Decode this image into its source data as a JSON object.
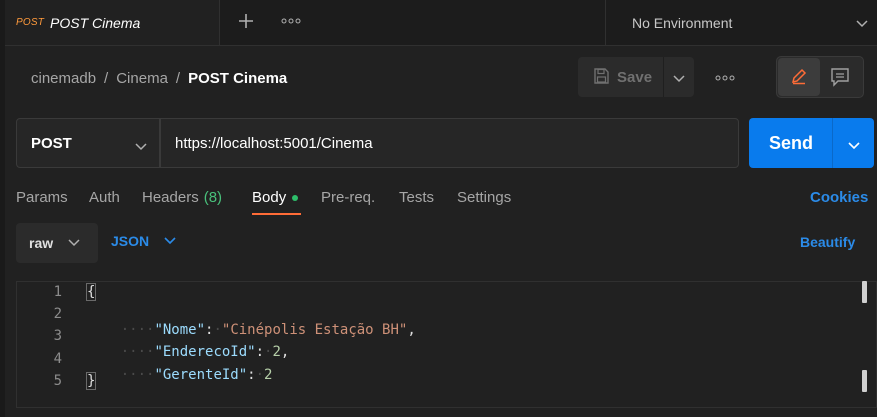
{
  "tab": {
    "method": "POST",
    "title": "POST Cinema"
  },
  "environment": {
    "label": "No Environment"
  },
  "breadcrumb": {
    "collection": "cinemadb",
    "folder": "Cinema",
    "request": "POST Cinema",
    "sep": "/"
  },
  "toolbar": {
    "save_label": "Save"
  },
  "request": {
    "method": "POST",
    "url": "https://localhost:5001/Cinema",
    "send_label": "Send"
  },
  "tabs": {
    "params": "Params",
    "auth": "Auth",
    "headers": "Headers",
    "headers_count": "(8)",
    "body": "Body",
    "prereq": "Pre-req.",
    "tests": "Tests",
    "settings": "Settings",
    "cookies": "Cookies"
  },
  "body_options": {
    "mode": "raw",
    "format": "JSON",
    "beautify": "Beautify"
  },
  "editor": {
    "line_numbers": [
      "1",
      "2",
      "3",
      "4",
      "5"
    ],
    "open_brace": "{",
    "close_brace": "}",
    "fields": [
      {
        "key": "\"Nome\"",
        "colon": ":",
        "value": "\"Cinépolis Estação BH\"",
        "comma": ","
      },
      {
        "key": "\"EnderecoId\"",
        "colon": ":",
        "value": "2",
        "comma": ","
      },
      {
        "key": "\"GerenteId\"",
        "colon": ":",
        "value": "2",
        "comma": ""
      }
    ]
  },
  "colors": {
    "accent": "#ff6c37",
    "send": "#097bed",
    "link": "#2b8be8",
    "headers_count": "#49c07b",
    "body_dot": "#2dbe6a"
  }
}
